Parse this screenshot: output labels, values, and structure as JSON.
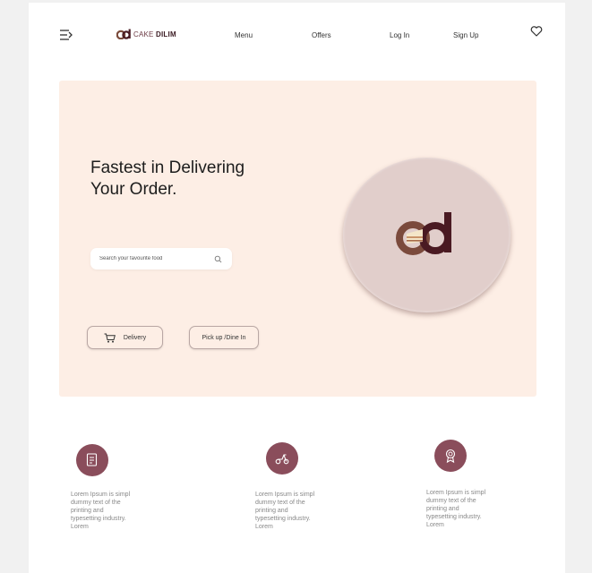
{
  "brand": {
    "name_part1": "CAKE",
    "name_part2": "DILIM"
  },
  "nav": {
    "menu": "Menu",
    "offers": "Offers",
    "login": "Log In",
    "signup": "Sign Up"
  },
  "hero": {
    "headline_line1": "Fastest in Delivering",
    "headline_line2": "Your Order.",
    "search_placeholder": "Search your favourite food",
    "delivery_label": "Delivery",
    "pickup_label": "Pick up /Dine In"
  },
  "features": [
    {
      "icon": "receipt-icon",
      "text": "Lorem Ipsum is simpl dummy text of the printing and typesetting industry. Lorem"
    },
    {
      "icon": "scooter-icon",
      "text": "Lorem Ipsum is simpl dummy text of the printing and typesetting industry. Lorem"
    },
    {
      "icon": "award-icon",
      "text": "Lorem Ipsum is simpl dummy text of the printing and typesetting industry. Lorem"
    }
  ],
  "colors": {
    "page_bg": "#f1f1f1",
    "hero_bg": "#fdeee5",
    "circle_bg": "#e1cecb",
    "accent": "#8a4d5b",
    "brand_dark": "#3a1a22"
  }
}
